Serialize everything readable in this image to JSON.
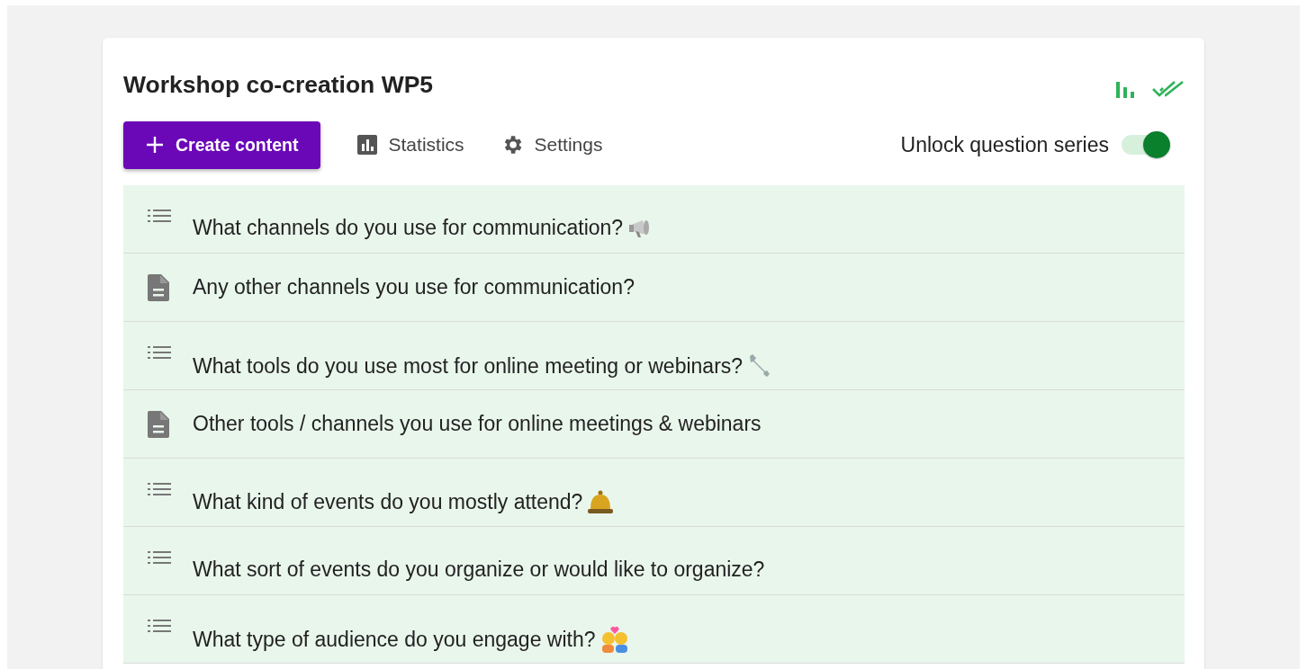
{
  "title": "Workshop co-creation WP5",
  "toolbar": {
    "create_button": "Create content",
    "statistics": "Statistics",
    "settings": "Settings"
  },
  "unlock": {
    "label": "Unlock question series",
    "on": true
  },
  "questions": [
    {
      "kind": "choice",
      "text": "What channels do you use for communication?"
    },
    {
      "kind": "text",
      "text": "Any other channels you use for communication?"
    },
    {
      "kind": "choice",
      "text": "What tools do you use most for online meeting or webinars?"
    },
    {
      "kind": "text",
      "text": "Other tools / channels you use for online meetings & webinars"
    },
    {
      "kind": "choice",
      "text": "What kind of events do you mostly attend?"
    },
    {
      "kind": "choice",
      "text": "What sort of events do you organize or would like to organize?"
    },
    {
      "kind": "choice",
      "text": "What type of audience do you engage with?"
    }
  ]
}
